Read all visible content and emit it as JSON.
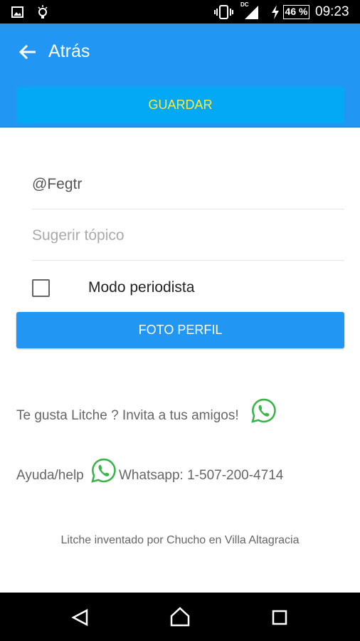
{
  "status_bar": {
    "battery": "46 %",
    "time": "09:23",
    "network": "DC"
  },
  "app_bar": {
    "title": "Atrás",
    "save_label": "GUARDAR"
  },
  "form": {
    "username_value": "@Fegtr",
    "topic_placeholder": "Sugerir tópico",
    "journalist_mode_label": "Modo periodista",
    "journalist_mode_checked": false,
    "photo_button_label": "FOTO PERFIL"
  },
  "info": {
    "invite_text": "Te gusta Litche ? Invita a tus amigos!",
    "help_prefix": "Ayuda/help",
    "help_suffix": "Whatsapp: 1-507-200-4714",
    "footer": "Litche inventado por Chucho en Villa Altagracia"
  },
  "colors": {
    "primary": "#2196F3",
    "save_bg": "#03A9F4",
    "save_text": "#FFEB3B",
    "whatsapp": "#3BB44A"
  }
}
